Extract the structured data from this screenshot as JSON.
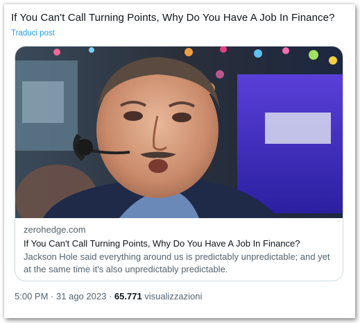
{
  "post": {
    "text": "If You Can't Call Turning Points, Why Do You Have A Job In Finance?",
    "translate_label": "Traduci post"
  },
  "card": {
    "domain": "zerohedge.com",
    "title": "If You Can't Call Turning Points, Why Do You Have A Job In Finance?",
    "description": "Jackson Hole said everything around us is predictably unpredictable; and yet at the same time it's also unpredictably predictable.",
    "image_icon": "trader-photo"
  },
  "meta": {
    "time": "5:00 PM",
    "separator": "·",
    "date": "31 ago 2023",
    "views_count": "65.771",
    "views_label": "visualizzazioni"
  },
  "colors": {
    "link": "#1d9bf0",
    "secondary_text": "#536471",
    "primary_text": "#0f1419",
    "border": "#cfd9de"
  }
}
